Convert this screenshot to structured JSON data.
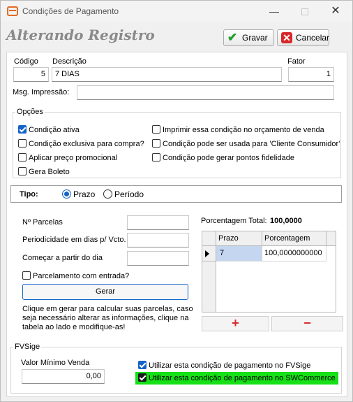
{
  "window": {
    "title": "Condições de Pagamento",
    "minimize": "—",
    "close": "✕"
  },
  "heading": "Alterando Registro",
  "toolbar": {
    "save_label": "Gravar",
    "cancel_label": "Cancelar"
  },
  "form": {
    "codigo_label": "Código",
    "codigo_value": "5",
    "descricao_label": "Descrição",
    "descricao_value": "7 DIAS",
    "fator_label": "Fator",
    "fator_value": "1",
    "msg_label": "Msg. Impressão:",
    "msg_value": ""
  },
  "opcoes": {
    "title": "Opções",
    "items": [
      {
        "label": "Condição ativa",
        "checked": true
      },
      {
        "label": "Condição exclusiva para compra?",
        "checked": false
      },
      {
        "label": "Aplicar preço promocional",
        "checked": false
      },
      {
        "label": "Gera Boleto",
        "checked": false
      },
      {
        "label": "Imprimir essa condição  no orçamento de venda",
        "checked": false
      },
      {
        "label": "Condição pode ser usada para 'Cliente Consumidor'",
        "checked": false
      },
      {
        "label": "Condição pode gerar pontos fidelidade",
        "checked": false
      }
    ]
  },
  "tipo": {
    "label": "Tipo:",
    "option_prazo": "Prazo",
    "option_periodo": "Período",
    "selected": "Prazo"
  },
  "parcelas": {
    "num_label": "Nº Parcelas",
    "num_value": "",
    "periodicidade_label": "Periodicidade em dias p/ Vcto.",
    "periodicidade_value": "",
    "comecar_label": "Começar a partir do dia",
    "comecar_value": "",
    "entrada_label": "Parcelamento com entrada?",
    "gerar_label": "Gerar",
    "help_text": "Clique em gerar para calcular suas parcelas, caso seja necessário alterar as informações, clique na tabela ao lado e modifique-as!"
  },
  "porcentagem": {
    "total_label": "Porcentagem Total:",
    "total_value": "100,0000",
    "columns": [
      "Prazo",
      "Porcentagem"
    ],
    "rows": [
      {
        "prazo": "7",
        "porcentagem": "100,0000000000"
      }
    ],
    "add_label": "+",
    "remove_label": "−"
  },
  "fvsige": {
    "title": "FVSige",
    "valor_label": "Valor Mínimo Venda",
    "valor_value": "0,00",
    "fvsige_check_label": "Utilizar esta condição de pagamento no FVSige",
    "swcommerce_check_label": "Utilizar esta condição de pagamento no SWCommerce",
    "highlight_color": "#16e016"
  }
}
